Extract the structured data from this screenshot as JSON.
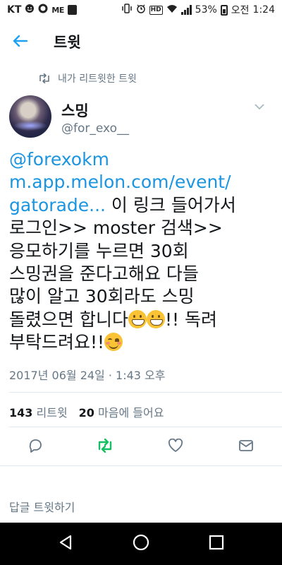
{
  "status_bar": {
    "carrier": "KT",
    "left_icons": [
      "smiley-icon",
      "circle-icon",
      "me-icon",
      "notification-square-icon"
    ],
    "battery": "53%",
    "ampm": "오전",
    "time": "1:24",
    "right_icons": [
      "vibrate-icon",
      "alarm-icon",
      "hd-icon",
      "wifi-icon",
      "signal-icon",
      "battery-icon"
    ]
  },
  "header": {
    "back_icon": "back-arrow-icon",
    "title": "트윗"
  },
  "retweet_context": {
    "icon": "retweet-icon",
    "label": "내가 리트윗한 트윗"
  },
  "tweet": {
    "author_name": "스밍",
    "author_handle": "@for_exo__",
    "text": {
      "mention": "@forexokm",
      "link_line1": "m.app.melon.com/event/",
      "link_line2": "gatorade...",
      "line3_rest": " 이 링크 들어가서",
      "line4": "로그인>> moster 검색>>",
      "line5": "응모하기를 누르면 30회",
      "line6": "스밍권을 준다고해요 다들",
      "line7": "많이 알고 30회라도 스밍",
      "line8_start": "돌렸으면 합니다",
      "line8_end": "!! 독려",
      "line9_start": "부탁드려요!!",
      "emojis": [
        "grinning-face",
        "grinning-face",
        "smiling-face-with-blush"
      ]
    },
    "timestamp": "2017년 06월 24일 · 1:43 오후",
    "stats": {
      "retweets_count": "143",
      "retweets_label": "리트윗",
      "likes_count": "20",
      "likes_label": "마음에 들어요"
    },
    "actions": [
      "reply-icon",
      "retweet-icon",
      "like-heart-icon",
      "direct-message-icon"
    ],
    "retweeted_color": "#17bf63"
  },
  "reply_prompt": "답글 트윗하기",
  "nav_bar": [
    "back-triangle-icon",
    "home-circle-icon",
    "recents-square-icon"
  ],
  "colors": {
    "accent": "#1da1f2",
    "link": "#1b95e0",
    "secondary_text": "#657786",
    "retweet_green": "#17bf63"
  }
}
